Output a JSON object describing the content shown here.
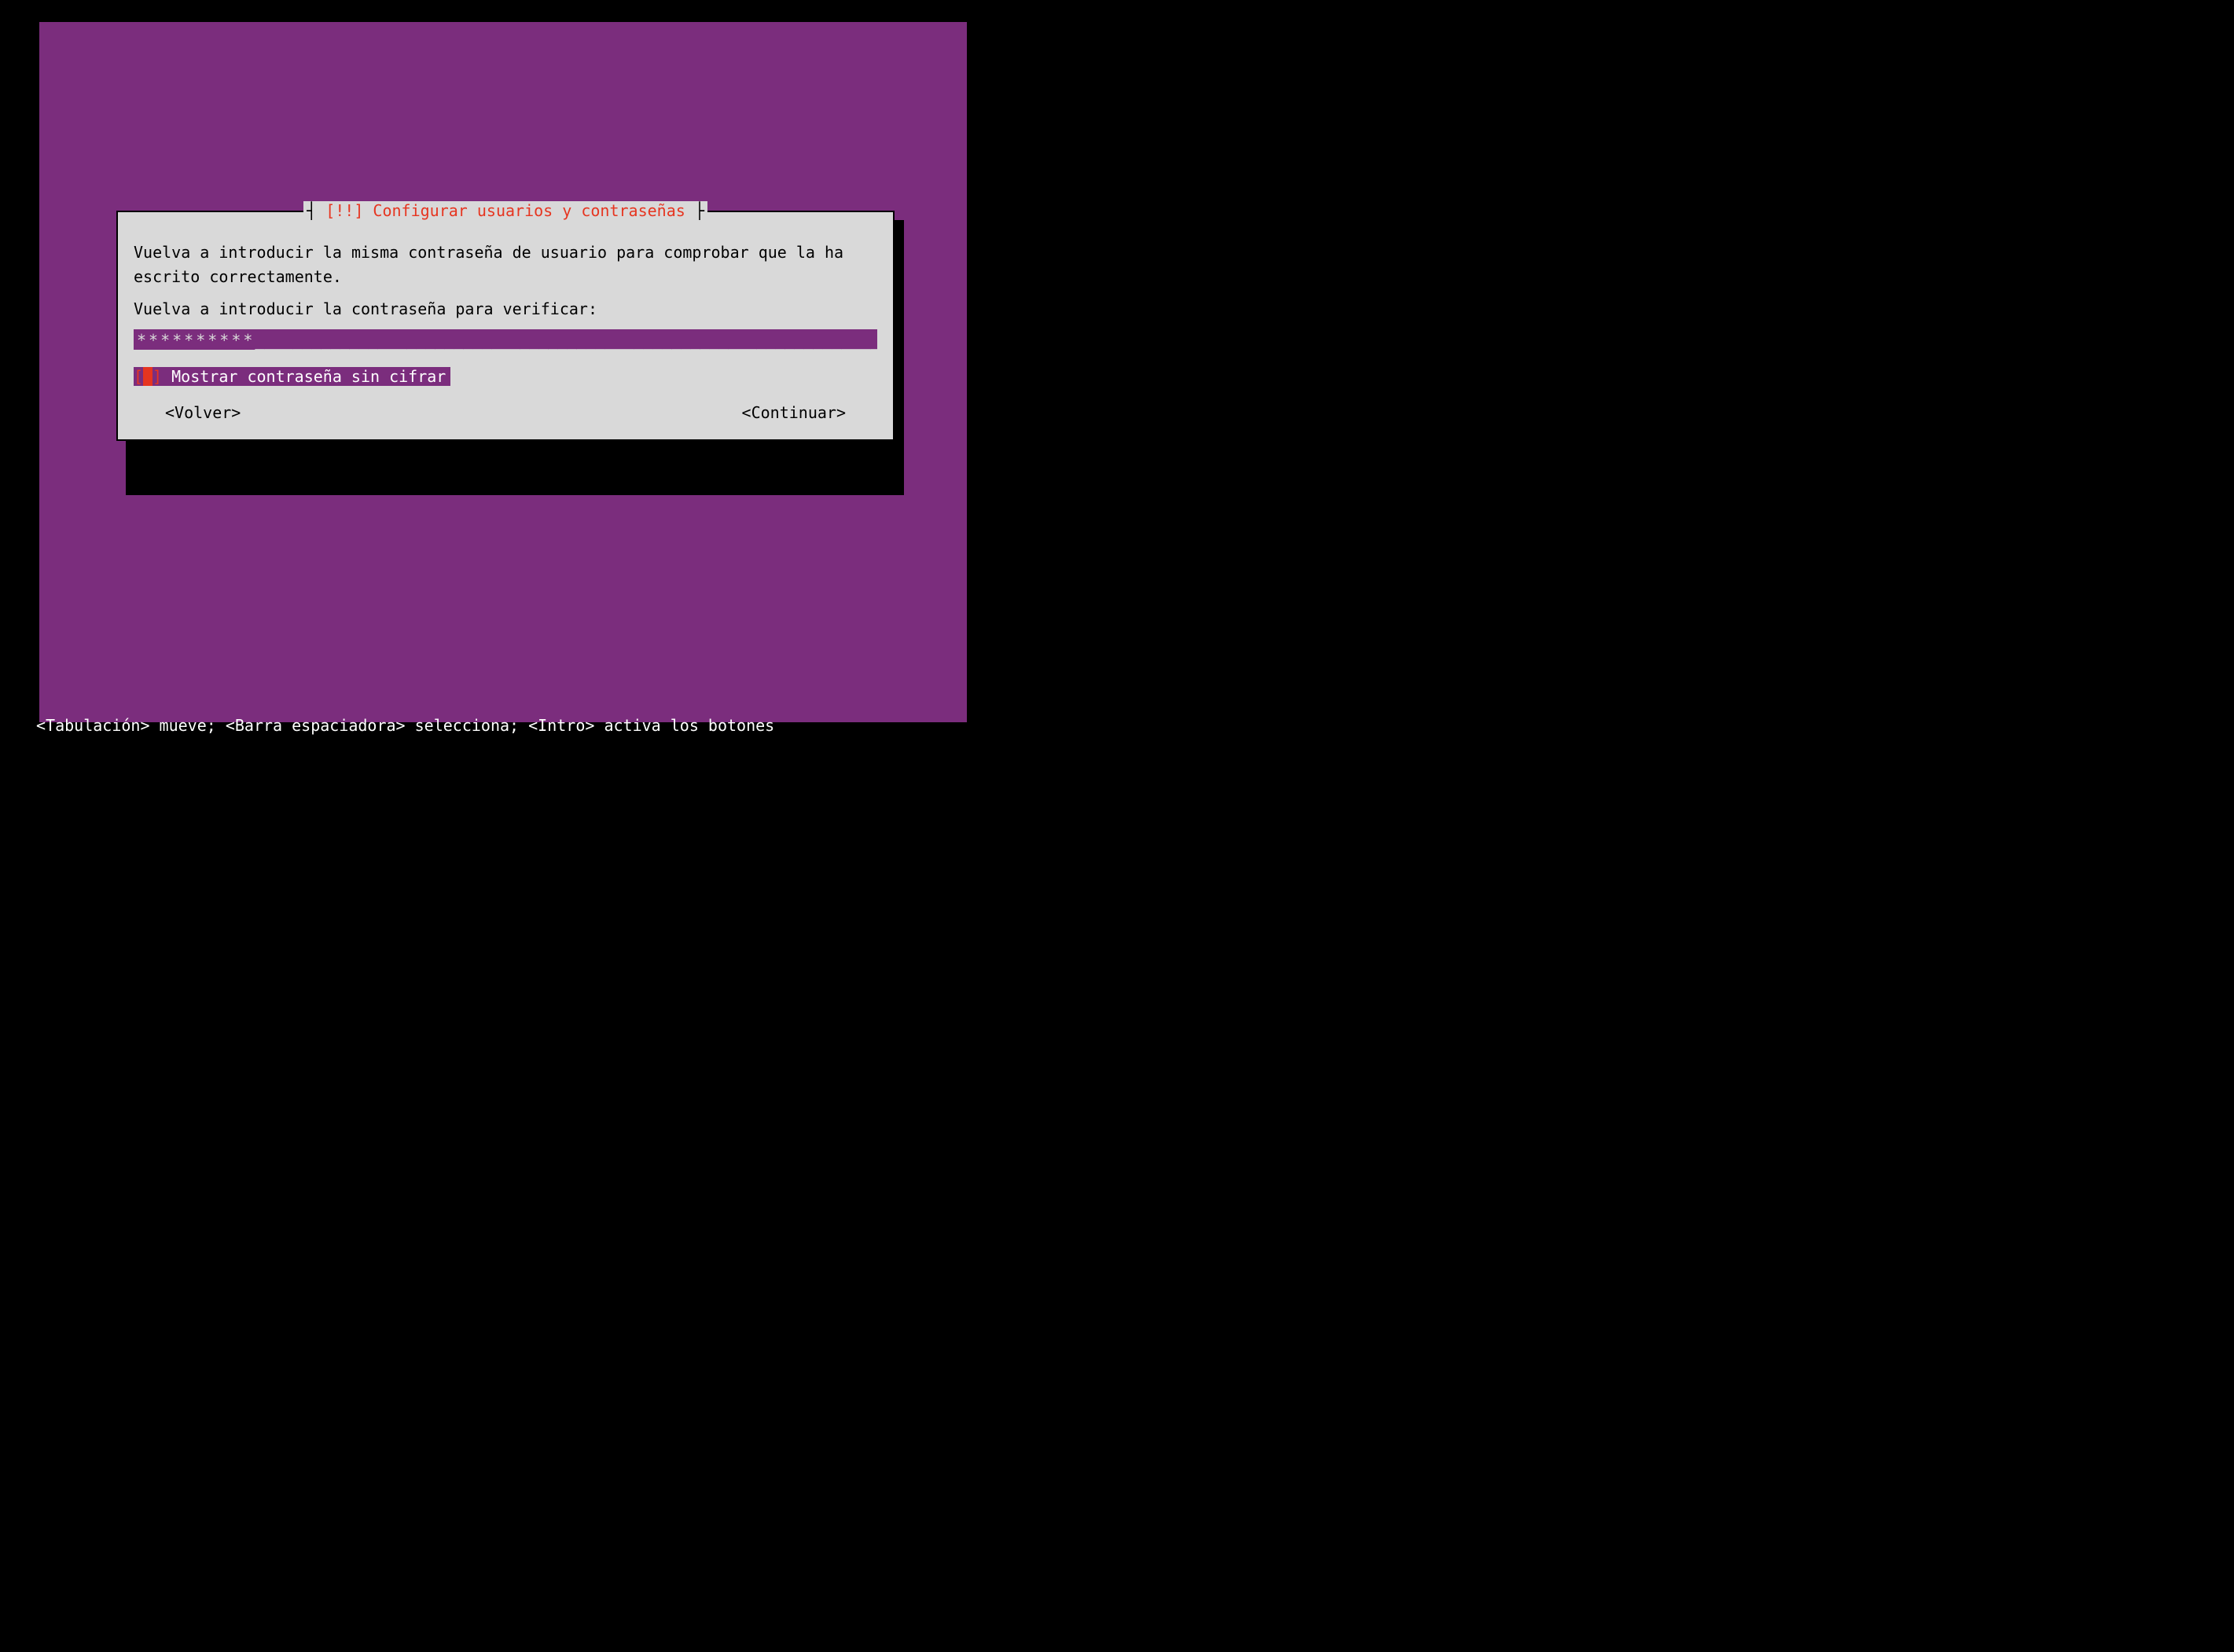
{
  "dialog": {
    "title_prefix": "[!!]",
    "title": "Configurar usuarios y contraseñas",
    "instruction": "Vuelva a introducir la misma contraseña de usuario para comprobar que la ha escrito correctamente.",
    "prompt": "Vuelva a introducir la contraseña para verificar:",
    "password_value": "**********",
    "password_fill": "________________________________________________________________________",
    "checkbox": {
      "label": "Mostrar contraseña sin cifrar",
      "checked": false
    },
    "back_button": "<Volver>",
    "continue_button": "<Continuar>"
  },
  "footer": "<Tabulación> mueve; <Barra espaciadora> selecciona; <Intro> activa los botones"
}
